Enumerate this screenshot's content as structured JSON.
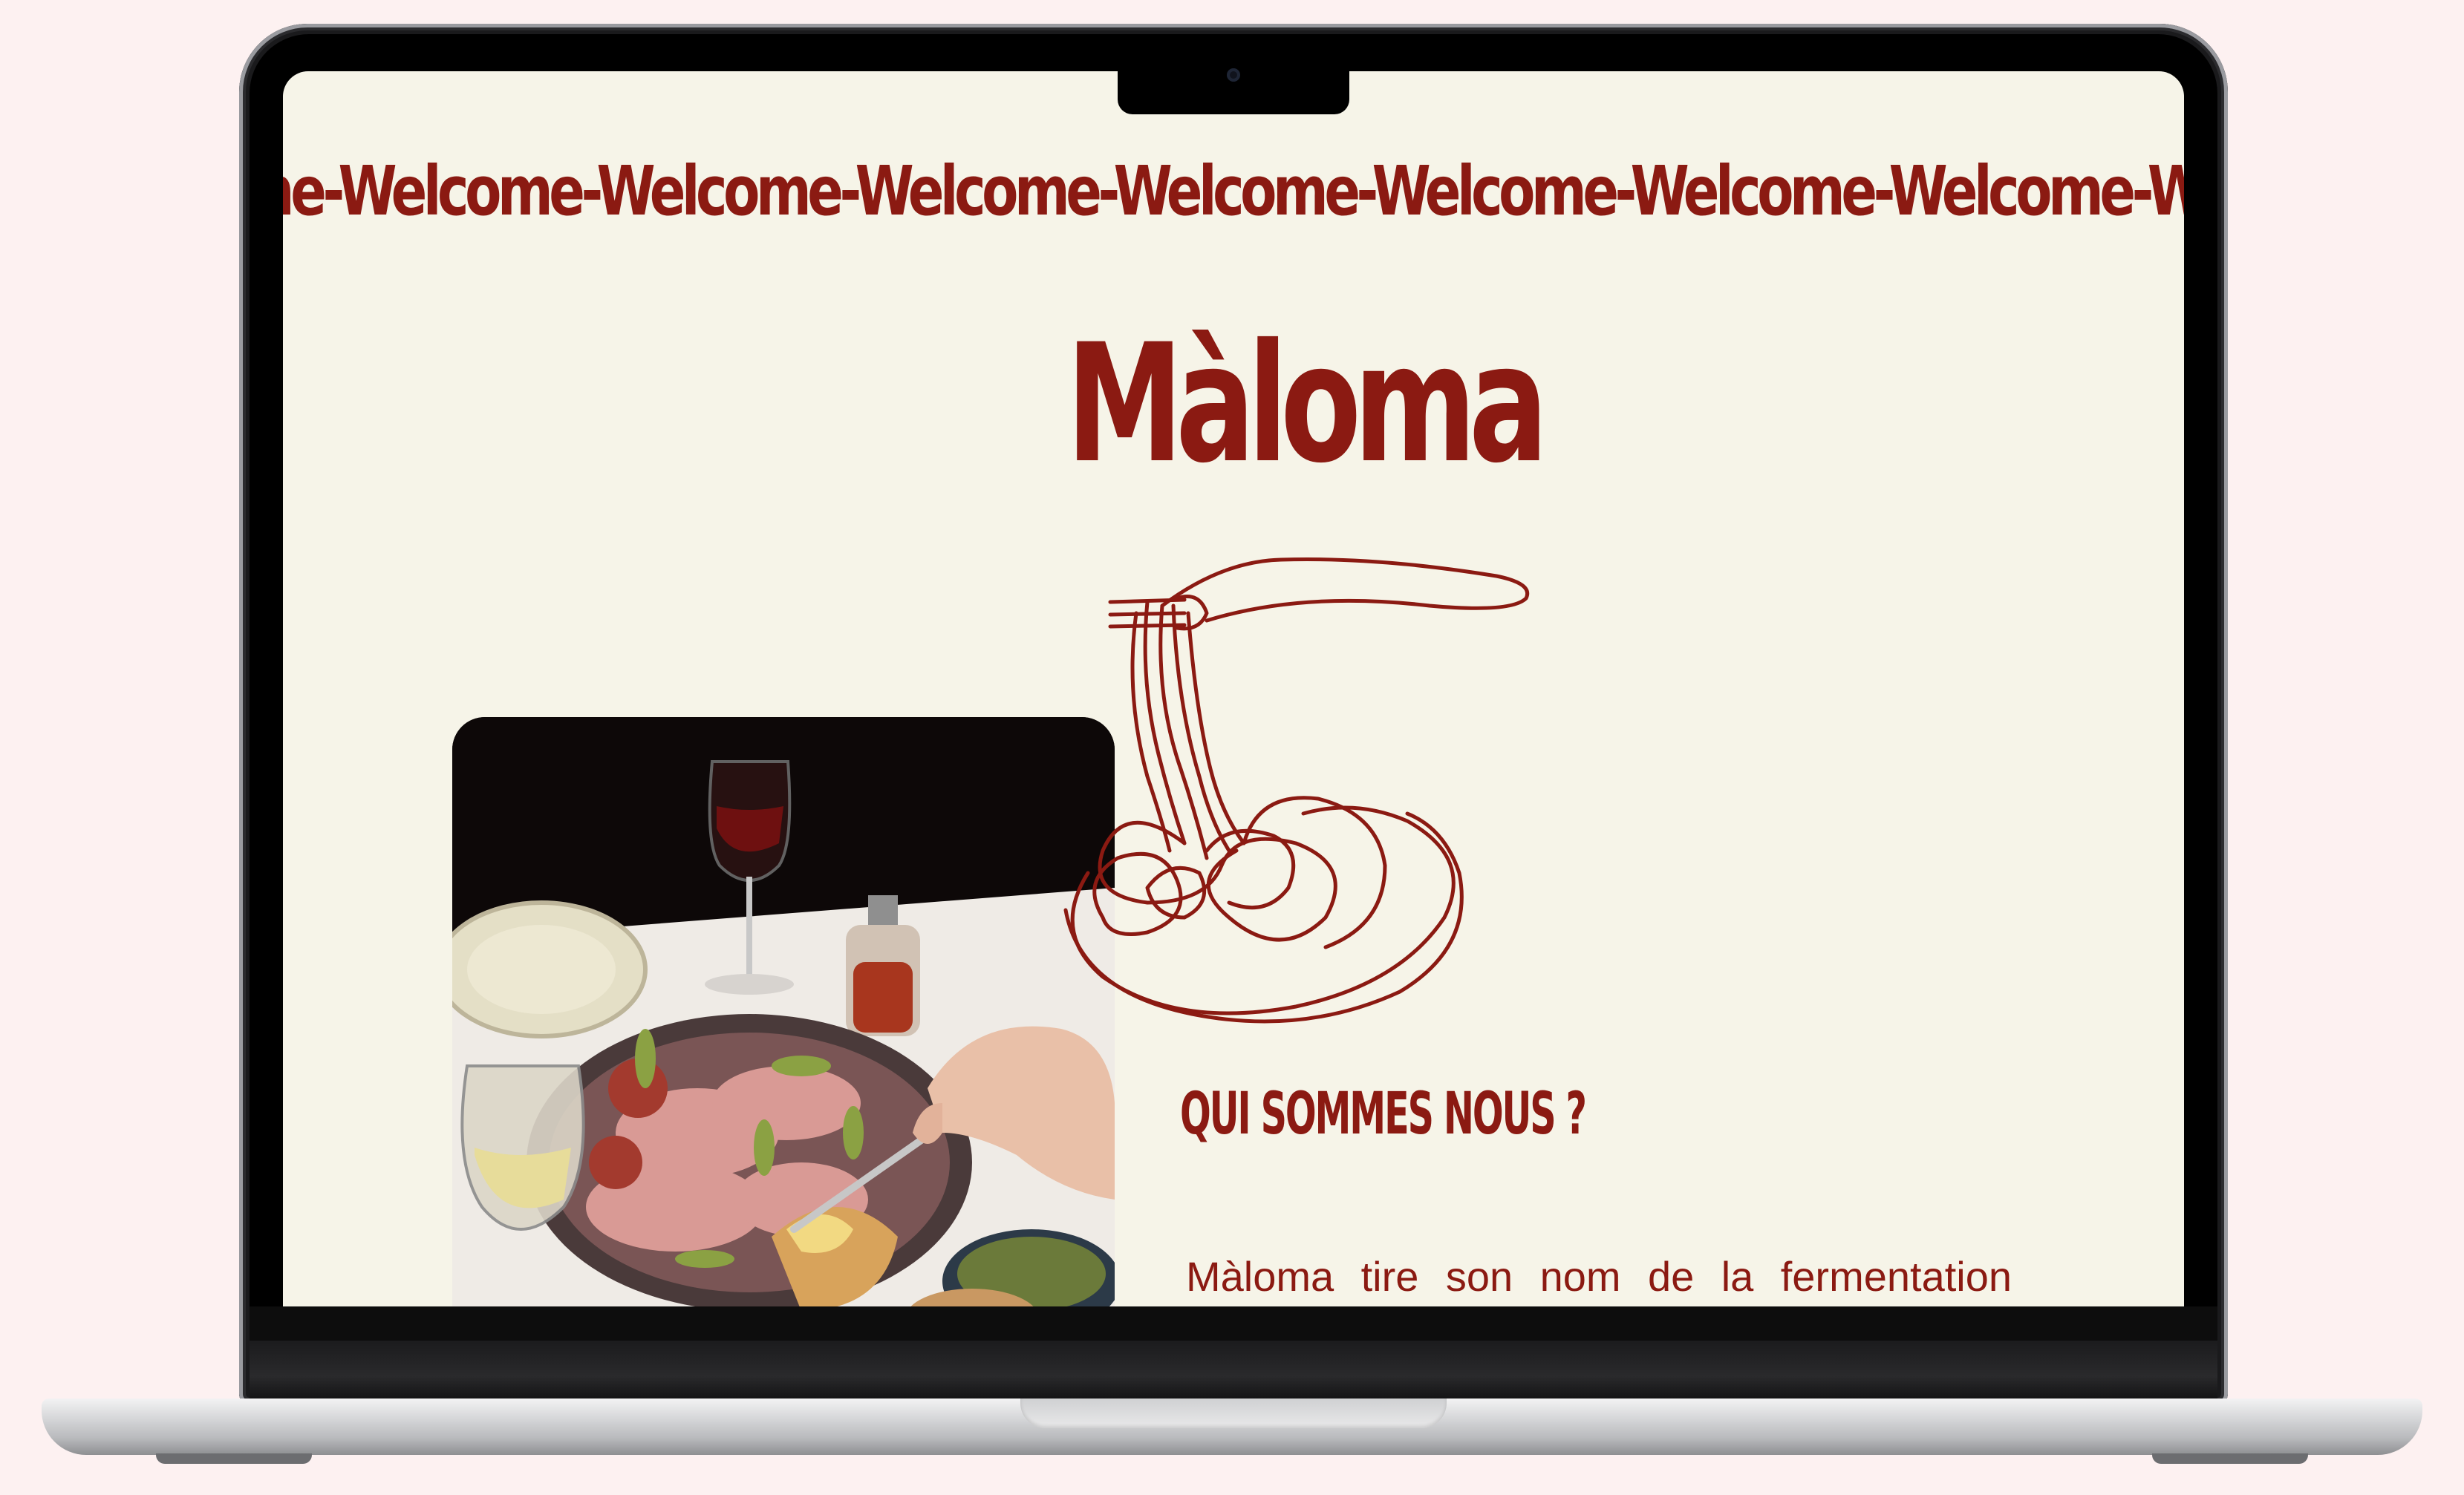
{
  "page": {
    "marquee_text": "come-Welcome-Welcome-Welcome-Welcome-Welcome-Welcome-Welcome-Welcome-Welcome-Welcom",
    "brand_name": "Màloma",
    "section_title": "QUI SOMMES NOUS ?",
    "intro_text": "Màloma tire son nom de la fermentation malolactique, un"
  },
  "colors": {
    "accent": "#8b1a12",
    "background": "#f6f4e8",
    "outer_background": "#fdf1f1"
  },
  "icons": {
    "logo": "pasta-fork-icon"
  },
  "images": {
    "hero_photo": "restaurant table with charcuterie platter, wine glasses and a hand holding a fork"
  }
}
